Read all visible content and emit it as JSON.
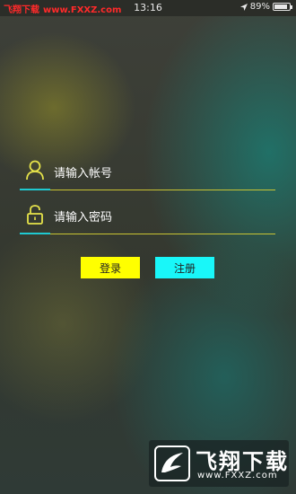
{
  "status_bar": {
    "left_text": "飞翔下载",
    "left_url": "www.FXXZ.com",
    "time": "13:16",
    "battery_percent": "89%",
    "battery_level": 0.89
  },
  "login": {
    "account_placeholder": "请输入帐号",
    "password_placeholder": "请输入密码",
    "login_label": "登录",
    "register_label": "注册"
  },
  "watermark": {
    "title": "飞翔下载",
    "url": "www.FXXZ.com"
  },
  "colors": {
    "login_button": "#ffff00",
    "register_button": "#19f7f9",
    "underline": "#c9c433",
    "underline_accent": "#1fc9d1",
    "icon": "#e6e34a"
  },
  "icons": [
    "user-icon",
    "lock-icon",
    "location-arrow-icon",
    "battery-icon",
    "fxxz-logo"
  ]
}
